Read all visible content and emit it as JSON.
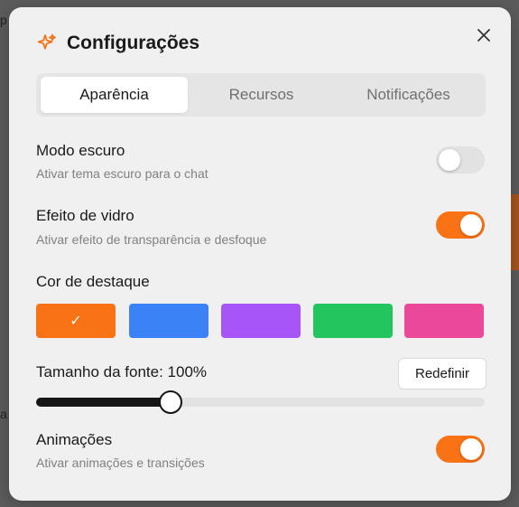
{
  "backdrop": {
    "frag_top": "p",
    "frag_mid": "a"
  },
  "dialog": {
    "title": "Configurações",
    "icon": "sparkles-icon",
    "close_icon": "close-icon",
    "accent_color": "#f97316"
  },
  "tabs": [
    {
      "label": "Aparência",
      "active": true
    },
    {
      "label": "Recursos",
      "active": false
    },
    {
      "label": "Notificações",
      "active": false
    }
  ],
  "dark_mode": {
    "title": "Modo escuro",
    "subtitle": "Ativar tema escuro para o chat",
    "enabled": false
  },
  "glass_effect": {
    "title": "Efeito de vidro",
    "subtitle": "Ativar efeito de transparência e desfoque",
    "enabled": true
  },
  "accent": {
    "title": "Cor de destaque",
    "colors": [
      "#f97316",
      "#3b82f6",
      "#a855f7",
      "#22c55e",
      "#ec4899"
    ],
    "selected_index": 0,
    "check_glyph": "✓"
  },
  "font_size": {
    "label": "Tamanho da fonte: 100%",
    "reset_label": "Redefinir",
    "slider_fraction": 0.3
  },
  "animations": {
    "title": "Animações",
    "subtitle": "Ativar animações e transições",
    "enabled": true
  }
}
